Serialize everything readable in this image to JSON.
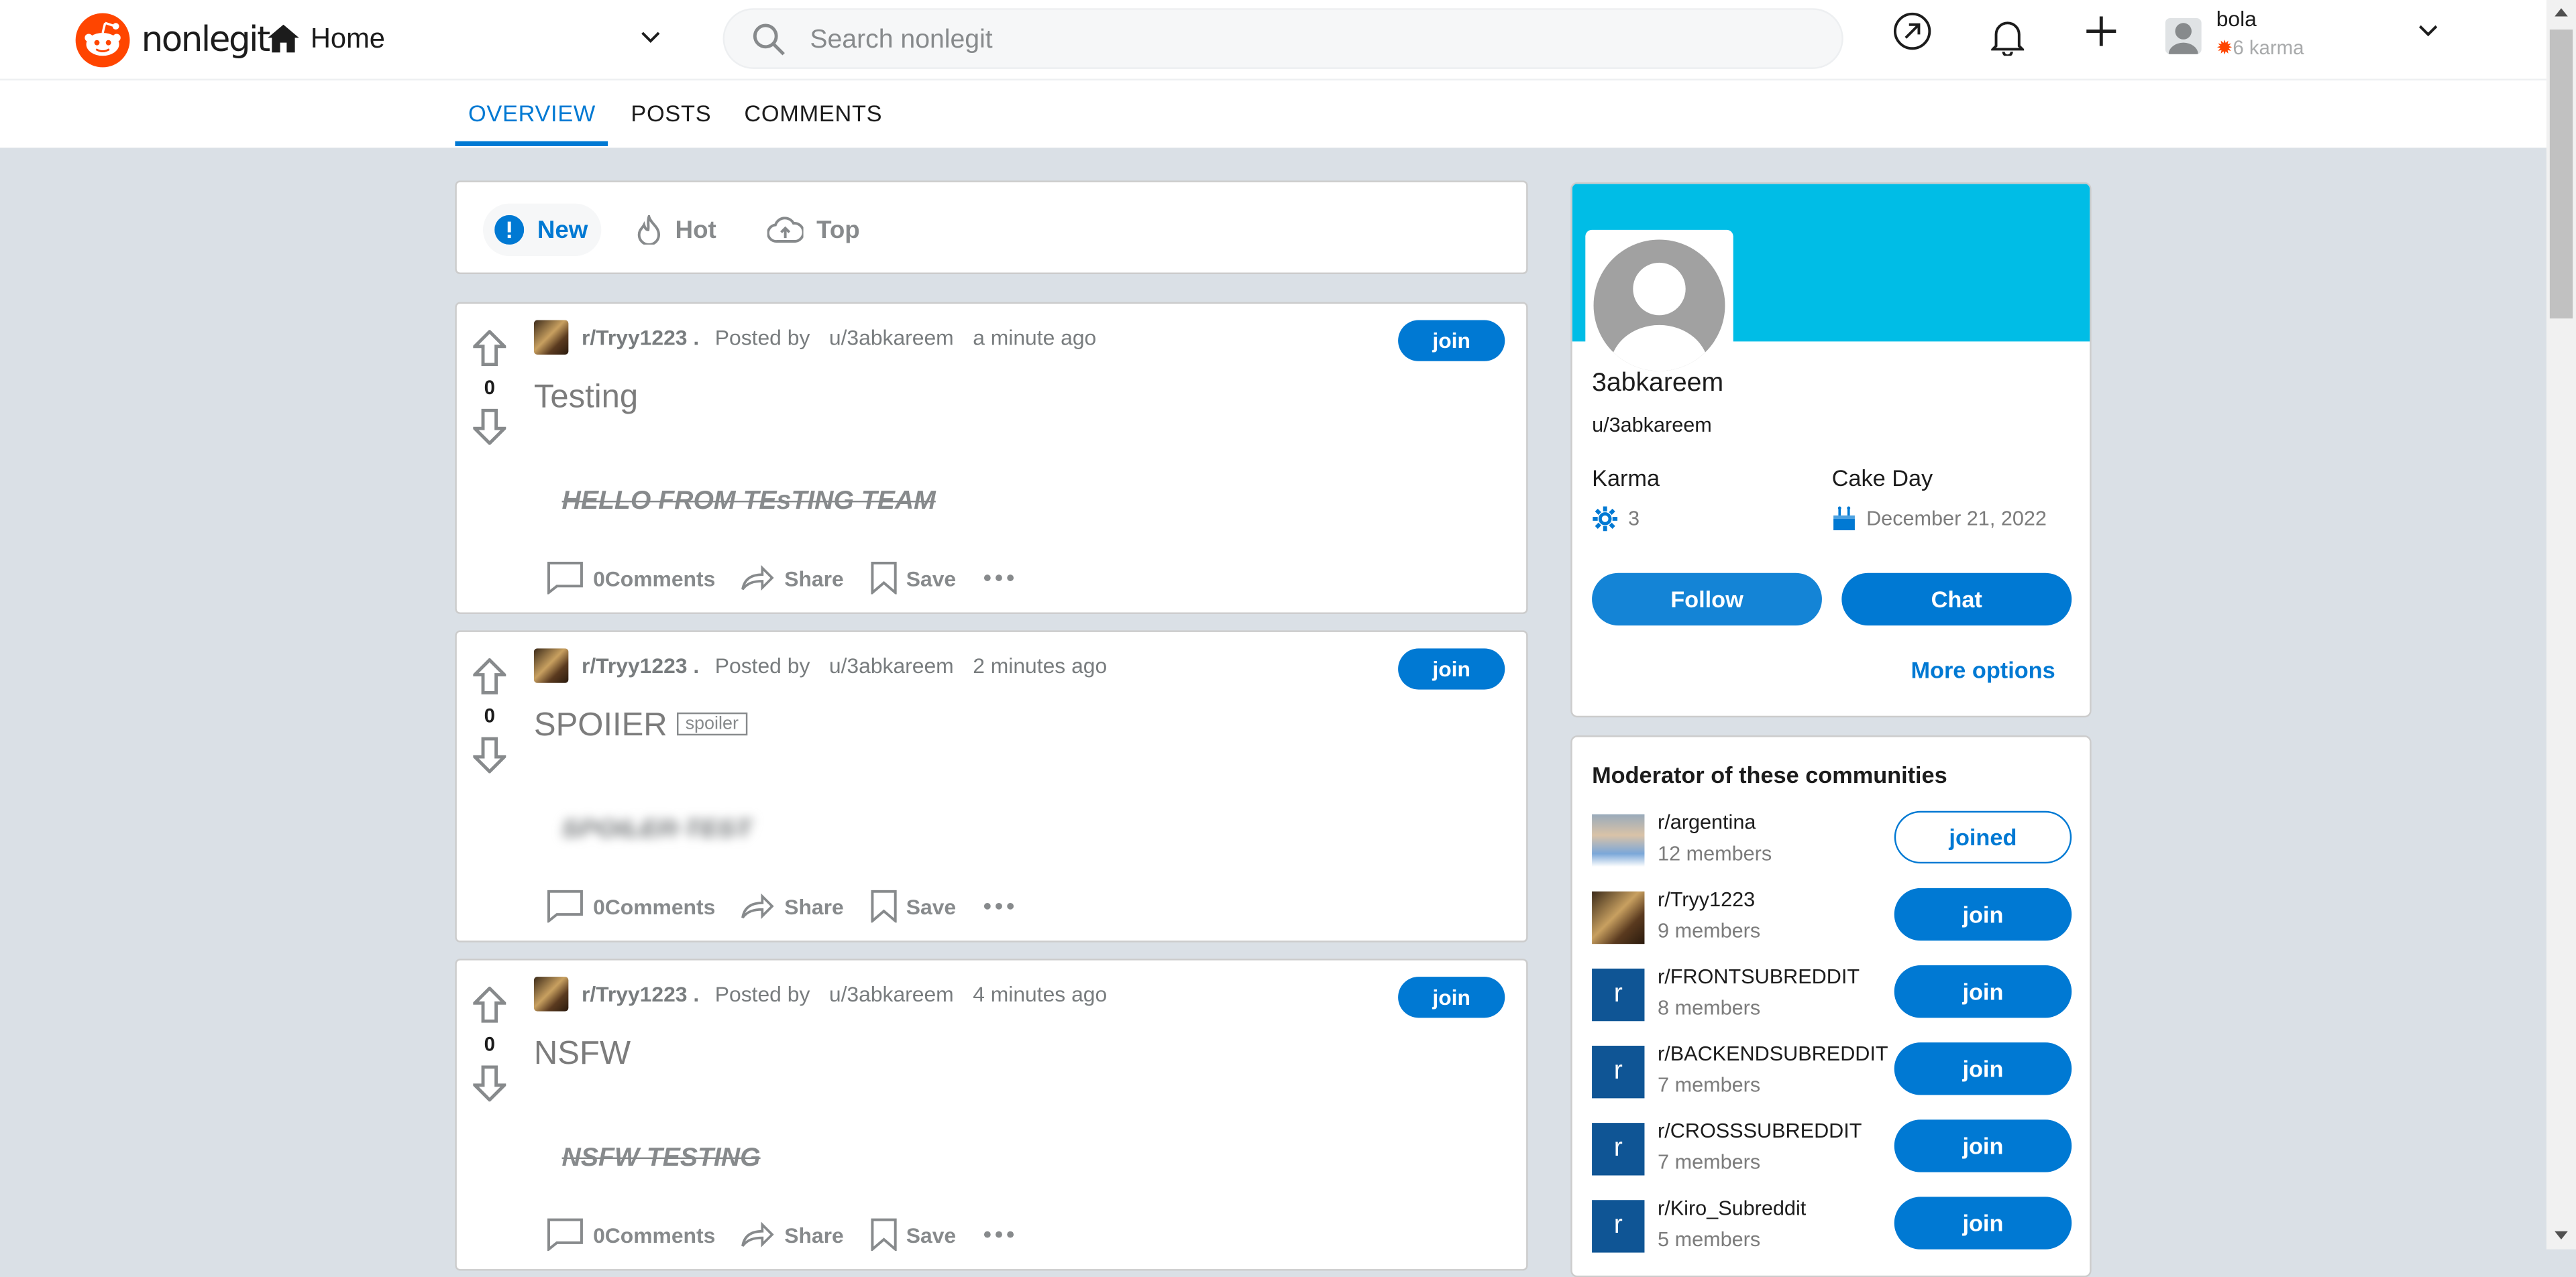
{
  "header": {
    "brand": "nonlegit",
    "home_label": "Home",
    "search_placeholder": "Search nonlegit",
    "username": "bola",
    "karma": "6 karma"
  },
  "profile_tabs": [
    "OVERVIEW",
    "POSTS",
    "COMMENTS"
  ],
  "sort": {
    "new": "New",
    "hot": "Hot",
    "top": "Top"
  },
  "posts": [
    {
      "sub": "r/Tryy1223 .",
      "posted_by": "Posted by",
      "user": "u/3abkareem",
      "time": "a minute ago",
      "join": "join",
      "votes": "0",
      "title": "Testing",
      "tag": "",
      "body": "HELLO FROM TEsTING TEAM",
      "comments": "0Comments",
      "share": "Share",
      "save": "Save"
    },
    {
      "sub": "r/Tryy1223 .",
      "posted_by": "Posted by",
      "user": "u/3abkareem",
      "time": "2 minutes ago",
      "join": "join",
      "votes": "0",
      "title": "SPOIIER",
      "tag": "spoiler",
      "body": "SPOILER TEST",
      "comments": "0Comments",
      "share": "Share",
      "save": "Save"
    },
    {
      "sub": "r/Tryy1223 .",
      "posted_by": "Posted by",
      "user": "u/3abkareem",
      "time": "4 minutes ago",
      "join": "join",
      "votes": "0",
      "title": "NSFW",
      "tag": "",
      "body": "NSFW TESTING",
      "comments": "0Comments",
      "share": "Share",
      "save": "Save"
    }
  ],
  "profile_card": {
    "display_name": "3abkareem",
    "username": "u/3abkareem",
    "karma_label": "Karma",
    "karma_value": "3",
    "cake_label": "Cake Day",
    "cake_value": "December 21, 2022",
    "follow": "Follow",
    "chat": "Chat",
    "more_options": "More options"
  },
  "moderator": {
    "title": "Moderator of these communities",
    "communities": [
      {
        "name": "r/argentina",
        "members": "12 members",
        "button": "joined",
        "letter": ""
      },
      {
        "name": "r/Tryy1223",
        "members": "9 members",
        "button": "join",
        "letter": ""
      },
      {
        "name": "r/FRONTSUBREDDIT",
        "members": "8 members",
        "button": "join",
        "letter": "r"
      },
      {
        "name": "r/BACKENDSUBREDDIT",
        "members": "7 members",
        "button": "join",
        "letter": "r"
      },
      {
        "name": "r/CROSSSUBREDDIT",
        "members": "7 members",
        "button": "join",
        "letter": "r"
      },
      {
        "name": "r/Kiro_Subreddit",
        "members": "5 members",
        "button": "join",
        "letter": "r"
      }
    ]
  },
  "colors": {
    "accent": "#0079d3",
    "brand": "#ff4500",
    "banner": "#00bde6",
    "page_bg": "#dae0e6"
  }
}
